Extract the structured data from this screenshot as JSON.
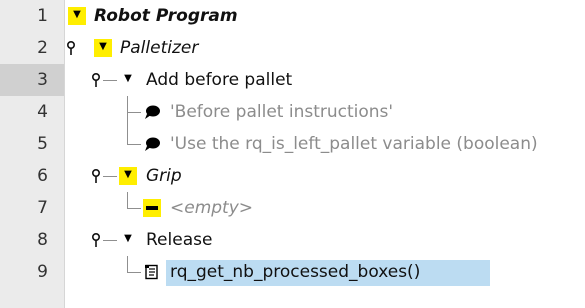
{
  "rows": [
    {
      "line": "1",
      "label": "Robot Program",
      "node": "program"
    },
    {
      "line": "2",
      "label": "Palletizer",
      "node": "folder"
    },
    {
      "line": "3",
      "label": "Add before pallet",
      "node": "folder"
    },
    {
      "line": "4",
      "label": "'Before pallet instructions'",
      "node": "comment"
    },
    {
      "line": "5",
      "label": "'Use the rq_is_left_pallet variable (boolean)",
      "node": "comment"
    },
    {
      "line": "6",
      "label": "Grip",
      "node": "folder"
    },
    {
      "line": "7",
      "label": "<empty>",
      "node": "empty"
    },
    {
      "line": "8",
      "label": "Release",
      "node": "folder"
    },
    {
      "line": "9",
      "label": "rq_get_nb_processed_boxes()",
      "node": "script"
    }
  ],
  "selected_line": "3",
  "highlighted_line": "9",
  "icons": {
    "expanded": "triangle-down-icon",
    "pin": "pin-icon",
    "comment": "speech-bubble-icon",
    "empty": "empty-placeholder-icon",
    "script": "script-icon"
  },
  "colors": {
    "gutter": "#ebebeb",
    "gutter_selected": "#d0d0d0",
    "node_yellow": "#ffee00",
    "highlight": "#bcdcf2",
    "muted_text": "#8c8c8c"
  }
}
